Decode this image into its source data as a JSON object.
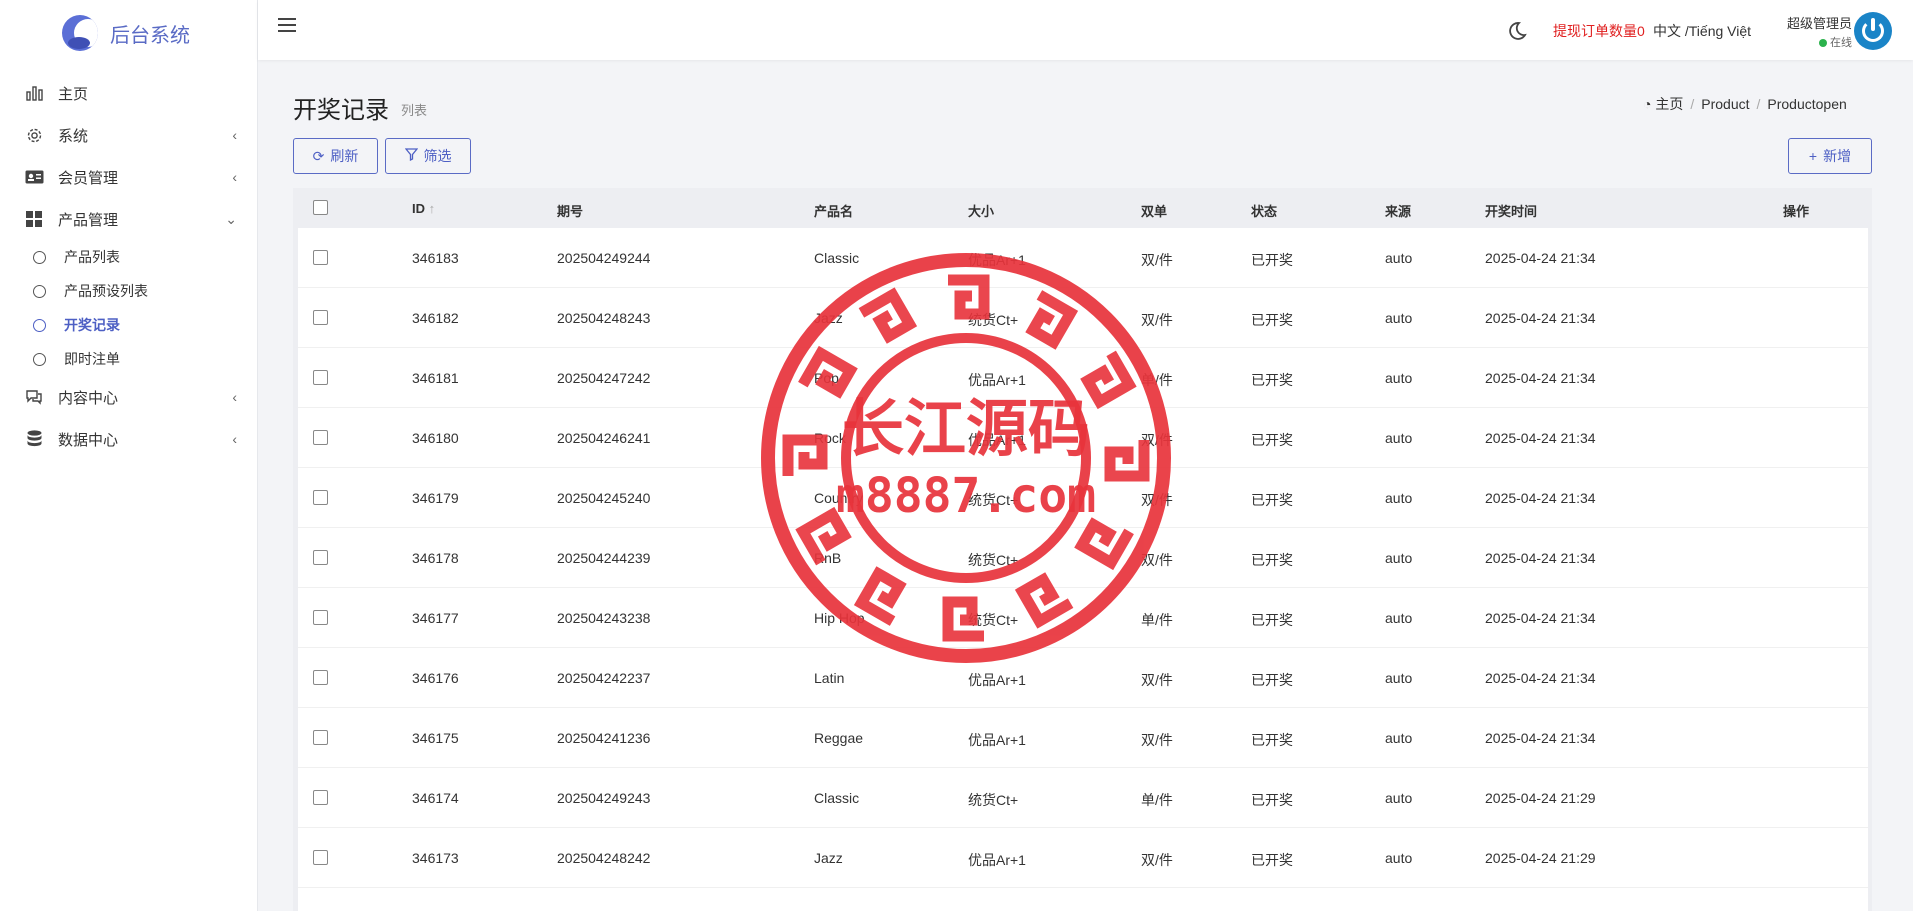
{
  "brand": {
    "name": "后台系统"
  },
  "sidebar": {
    "items": [
      {
        "label": "主页",
        "icon": "bar-chart-icon",
        "has_children": false
      },
      {
        "label": "系统",
        "icon": "gear-icon",
        "has_children": true,
        "expanded": false
      },
      {
        "label": "会员管理",
        "icon": "id-card-icon",
        "has_children": true,
        "expanded": false
      },
      {
        "label": "产品管理",
        "icon": "grid-icon",
        "has_children": true,
        "expanded": true
      },
      {
        "label": "内容中心",
        "icon": "chat-icon",
        "has_children": true,
        "expanded": false
      },
      {
        "label": "数据中心",
        "icon": "database-icon",
        "has_children": true,
        "expanded": false
      }
    ],
    "sub_items": [
      {
        "label": "产品列表",
        "active": false
      },
      {
        "label": "产品预设列表",
        "active": false
      },
      {
        "label": "开奖记录",
        "active": true
      },
      {
        "label": "即时注单",
        "active": false
      }
    ]
  },
  "header": {
    "withdraw_label": "提现订单数量0",
    "language": "中文 /Tiếng Việt",
    "user_name": "超级管理员",
    "user_status": "在线"
  },
  "page": {
    "title": "开奖记录",
    "subtitle": "列表",
    "breadcrumb": [
      "主页",
      "Product",
      "Productopen"
    ]
  },
  "toolbar": {
    "refresh_label": "刷新",
    "filter_label": "筛选",
    "add_label": "新增"
  },
  "table": {
    "columns": [
      "ID",
      "期号",
      "产品名",
      "大小",
      "双单",
      "状态",
      "来源",
      "开奖时间",
      "操作"
    ],
    "rows": [
      [
        "346183",
        "202504249244",
        "Classic",
        "优品Ar+1",
        "双/件",
        "已开奖",
        "auto",
        "2025-04-24 21:34"
      ],
      [
        "346182",
        "202504248243",
        "Jazz",
        "统货Ct+",
        "双/件",
        "已开奖",
        "auto",
        "2025-04-24 21:34"
      ],
      [
        "346181",
        "202504247242",
        "Pop",
        "优品Ar+1",
        "单/件",
        "已开奖",
        "auto",
        "2025-04-24 21:34"
      ],
      [
        "346180",
        "202504246241",
        "Rock",
        "优品Ar+1",
        "双/件",
        "已开奖",
        "auto",
        "2025-04-24 21:34"
      ],
      [
        "346179",
        "202504245240",
        "Country",
        "统货Ct+",
        "双/件",
        "已开奖",
        "auto",
        "2025-04-24 21:34"
      ],
      [
        "346178",
        "202504244239",
        "RnB",
        "统货Ct+",
        "双/件",
        "已开奖",
        "auto",
        "2025-04-24 21:34"
      ],
      [
        "346177",
        "202504243238",
        "Hip Hop",
        "统货Ct+",
        "单/件",
        "已开奖",
        "auto",
        "2025-04-24 21:34"
      ],
      [
        "346176",
        "202504242237",
        "Latin",
        "优品Ar+1",
        "双/件",
        "已开奖",
        "auto",
        "2025-04-24 21:34"
      ],
      [
        "346175",
        "202504241236",
        "Reggae",
        "优品Ar+1",
        "双/件",
        "已开奖",
        "auto",
        "2025-04-24 21:34"
      ],
      [
        "346174",
        "202504249243",
        "Classic",
        "统货Ct+",
        "单/件",
        "已开奖",
        "auto",
        "2025-04-24 21:29"
      ],
      [
        "346173",
        "202504248242",
        "Jazz",
        "优品Ar+1",
        "双/件",
        "已开奖",
        "auto",
        "2025-04-24 21:29"
      ]
    ]
  },
  "watermark": {
    "line1": "长江源码",
    "line2": "m8887.com",
    "color": "#e8333b"
  },
  "colors": {
    "accent": "#4d5fc4",
    "danger": "#e02020",
    "online": "#2bb24c"
  }
}
